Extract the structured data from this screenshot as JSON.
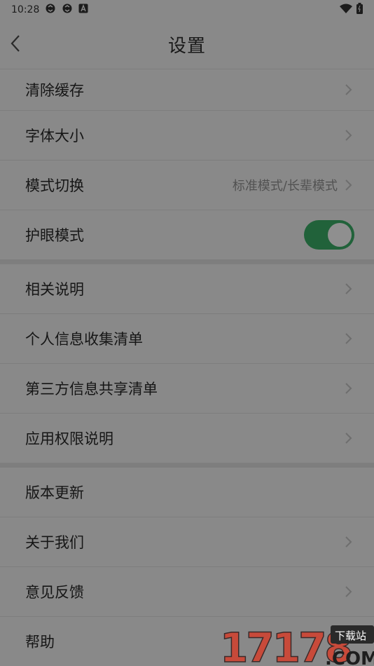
{
  "status": {
    "time": "10:28",
    "icons": [
      "sync-icon",
      "sync-icon",
      "a-box-icon"
    ],
    "right_icons": [
      "wifi-icon",
      "battery-icon"
    ]
  },
  "header": {
    "title": "设置",
    "back_icon": "chevron-left-icon"
  },
  "section1": [
    {
      "label": "清除缓存"
    },
    {
      "label": "字体大小"
    },
    {
      "label": "模式切换",
      "value": "标准模式/长辈模式"
    },
    {
      "label": "护眼模式",
      "toggle": true
    }
  ],
  "section2": [
    {
      "label": "相关说明"
    },
    {
      "label": "个人信息收集清单"
    },
    {
      "label": "第三方信息共享清单"
    },
    {
      "label": "应用权限说明"
    }
  ],
  "section3": [
    {
      "label": "版本更新"
    },
    {
      "label": "关于我们"
    },
    {
      "label": "意见反馈"
    },
    {
      "label": "帮助"
    }
  ],
  "watermark": {
    "main": "17178",
    "sub": ".COM",
    "tag": "下载站"
  },
  "colors": {
    "toggle_on": "#21623a",
    "watermark_red": "#c84a3a"
  }
}
